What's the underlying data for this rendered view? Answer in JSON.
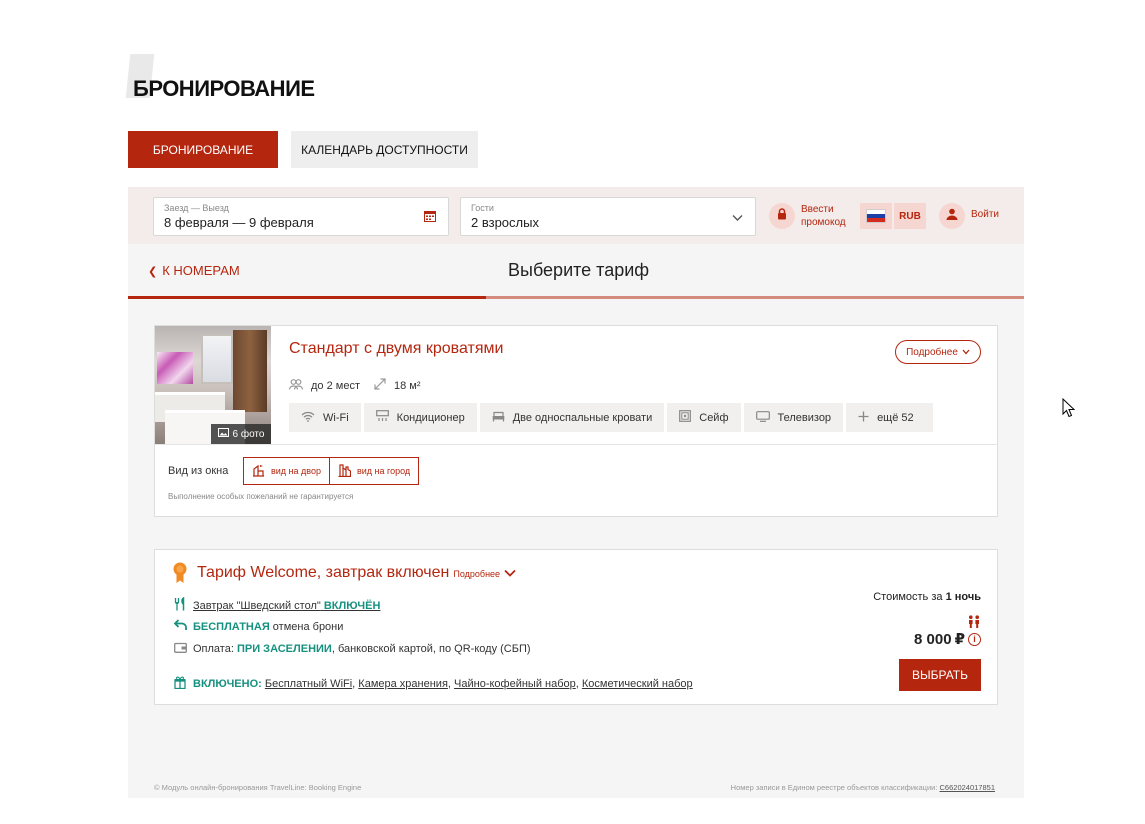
{
  "page_title": "БРОНИРОВАНИЕ",
  "tabs": [
    {
      "label": "БРОНИРОВАНИЕ",
      "active": true
    },
    {
      "label": "КАЛЕНДАРЬ ДОСТУПНОСТИ",
      "active": false
    }
  ],
  "search": {
    "dates_label": "Заезд — Выезд",
    "dates_value": "8 февраля — 9 февраля",
    "guests_label": "Гости",
    "guests_value": "2 взрослых",
    "promo_line1": "Ввести",
    "promo_line2": "промокод",
    "currency": "RUB",
    "login": "Войти"
  },
  "steps": {
    "back": "К НОМЕРАМ",
    "title": "Выберите тариф"
  },
  "room": {
    "name": "Стандарт с двумя кроватями",
    "details_btn": "Подробнее",
    "photos": "6 фото",
    "capacity": "до 2 мест",
    "area": "18 м²",
    "amenities": [
      "Wi-Fi",
      "Кондиционер",
      "Две односпальные кровати",
      "Сейф",
      "Телевизор",
      "ещё 52"
    ],
    "view_label": "Вид из окна",
    "views": [
      "вид на двор",
      "вид на город"
    ],
    "view_note": "Выполнение особых пожеланий не гарантируется"
  },
  "tariff": {
    "name": "Тариф Welcome, завтрак включен",
    "details": "Подробнее",
    "breakfast_text": "Завтрак \"Шведский стол\"",
    "breakfast_status": "ВКЛЮЧЁН",
    "cancel_bold": "БЕСПЛАТНАЯ",
    "cancel_text": "отмена брони",
    "payment_label": "Оплата:",
    "payment_bold": "ПРИ ЗАСЕЛЕНИИ",
    "payment_text": ", банковской картой, по QR-коду (СБП)",
    "included_label": "ВКЛЮЧЕНО:",
    "included_items": [
      "Бесплатный WiFi",
      "Камера хранения",
      "Чайно-кофейный набор",
      "Косметический набор"
    ],
    "cost_prefix": "Стоимость за",
    "cost_nights": "1 ночь",
    "price": "8 000",
    "currency_sign": "₽",
    "select_btn": "ВЫБРАТЬ"
  },
  "footer": {
    "left": "© Модуль онлайн-бронирования TravelLine: Booking Engine",
    "right_text": "Номер записи в Едином реестре объектов классификации:",
    "right_link": "C662024017851"
  },
  "colors": {
    "accent": "#b5260f",
    "teal": "#17917f"
  }
}
